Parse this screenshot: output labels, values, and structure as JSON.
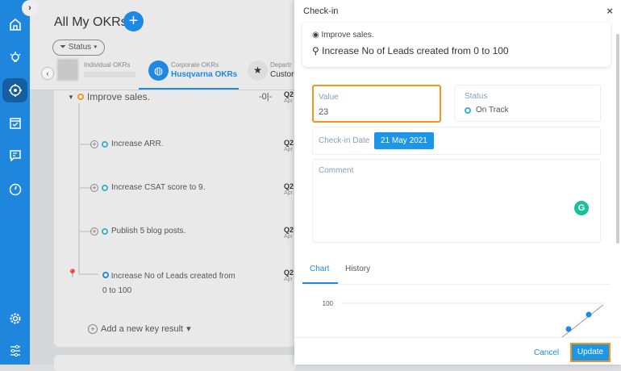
{
  "sidebar": {
    "items": [
      "home-icon",
      "lightbulb-icon",
      "target-icon",
      "calendar-check-icon",
      "chat-icon",
      "gauge-icon",
      "gear-icon",
      "sliders-icon"
    ],
    "active": "target-icon"
  },
  "header": {
    "title": "All My OKRs",
    "add_label": "+",
    "status_filter": "Status",
    "tabs": [
      {
        "sub": "Individual OKRs",
        "label": ""
      },
      {
        "sub": "Corporate OKRs",
        "label": "Husqvarna OKRs"
      },
      {
        "sub": "Departr",
        "label": "Custor"
      }
    ]
  },
  "okr": {
    "objective": "Improve sales.",
    "key_results": [
      {
        "title": "Increase ARR.",
        "quarter": "Q2",
        "date": "Apr"
      },
      {
        "title": "Increase CSAT score to 9.",
        "quarter": "Q2",
        "date": "Apr"
      },
      {
        "title": "Publish 5 blog posts.",
        "quarter": "Q2",
        "date": "Apr"
      },
      {
        "title": "Increase No of Leads created from",
        "title2": "0 to 100",
        "quarter": "Q2",
        "date": "Apr"
      }
    ],
    "objective_quarter": "Q2",
    "objective_date": "Apr",
    "add_kr": "Add a new key result"
  },
  "checkin": {
    "title": "Check-in",
    "close": "×",
    "objective": "Improve sales.",
    "key_result": "Increase No of Leads created from 0 to 100",
    "value_label": "Value",
    "value": "23",
    "status_label": "Status",
    "status": "On Track",
    "date_label": "Check-in Date",
    "date": "21 May 2021",
    "comment_label": "Comment",
    "tabs": [
      "Chart",
      "History"
    ],
    "cancel": "Cancel",
    "update": "Update"
  },
  "colors": {
    "primary": "#1e88e5",
    "highlight": "#f7941d",
    "on_track": "#35b3c8"
  },
  "chart_data": {
    "type": "line",
    "yticks": [
      "100"
    ],
    "ylim": [
      0,
      100
    ],
    "x": [
      1,
      2
    ],
    "y": [
      10,
      23
    ],
    "title": "",
    "xlabel": "",
    "ylabel": ""
  }
}
